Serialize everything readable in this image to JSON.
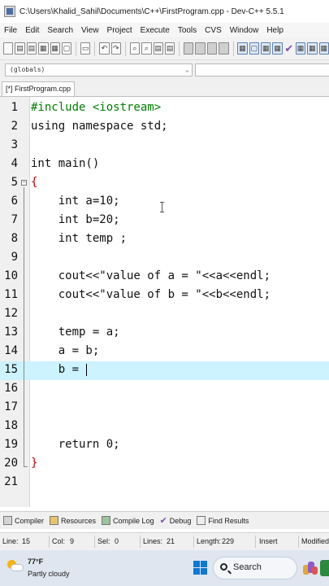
{
  "window": {
    "title": "C:\\Users\\Khalid_Sahil\\Documents\\C++\\FirstProgram.cpp - Dev-C++ 5.5.1"
  },
  "menu": [
    "File",
    "Edit",
    "Search",
    "View",
    "Project",
    "Execute",
    "Tools",
    "CVS",
    "Window",
    "Help"
  ],
  "toolbar": {
    "icons": [
      "new-file-icon",
      "open-project-icon",
      "open-file-icon",
      "save-icon",
      "save-all-icon",
      "close-icon",
      "print-icon",
      "undo-icon",
      "redo-icon",
      "find-icon",
      "replace-icon",
      "find-next-icon",
      "goto-line-icon",
      "indent-icon",
      "unindent-icon",
      "toggle-bookmark-icon",
      "goto-bookmark-icon",
      "compile-icon",
      "run-icon",
      "compile-run-icon",
      "rebuild-icon",
      "check-syntax-icon",
      "debug-icon",
      "profile-icon",
      "stop-icon"
    ]
  },
  "globals": {
    "value": "(globals)"
  },
  "file_tab": {
    "label": "[*] FirstProgram.cpp"
  },
  "editor": {
    "current_line": 15,
    "lines": [
      {
        "n": "1",
        "text": "#include <iostream>"
      },
      {
        "n": "2",
        "text": "using namespace std;"
      },
      {
        "n": "3",
        "text": ""
      },
      {
        "n": "4",
        "text": "int main()"
      },
      {
        "n": "5",
        "text": "{"
      },
      {
        "n": "6",
        "text": "    int a=10;"
      },
      {
        "n": "7",
        "text": "    int b=20;"
      },
      {
        "n": "8",
        "text": "    int temp ;"
      },
      {
        "n": "9",
        "text": ""
      },
      {
        "n": "10",
        "text": "    cout<<\"value of a = \"<<a<<endl;"
      },
      {
        "n": "11",
        "text": "    cout<<\"value of b = \"<<b<<endl;"
      },
      {
        "n": "12",
        "text": ""
      },
      {
        "n": "13",
        "text": "    temp = a;"
      },
      {
        "n": "14",
        "text": "    a = b;"
      },
      {
        "n": "15",
        "text": "    b = "
      },
      {
        "n": "16",
        "text": ""
      },
      {
        "n": "17",
        "text": ""
      },
      {
        "n": "18",
        "text": ""
      },
      {
        "n": "19",
        "text": "    return 0;"
      },
      {
        "n": "20",
        "text": "}"
      },
      {
        "n": "21",
        "text": ""
      }
    ]
  },
  "panel_tabs": [
    {
      "label": "Compiler",
      "icon": "compiler-icon"
    },
    {
      "label": "Resources",
      "icon": "resources-icon"
    },
    {
      "label": "Compile Log",
      "icon": "compile-log-icon"
    },
    {
      "label": "Debug",
      "icon": "debug-check-icon"
    },
    {
      "label": "Find Results",
      "icon": "find-results-icon"
    }
  ],
  "status": {
    "line_label": "Line:",
    "line_value": "15",
    "col_label": "Col:",
    "col_value": "9",
    "sel_label": "Sel:",
    "sel_value": "0",
    "lines_label": "Lines:",
    "lines_value": "21",
    "length_label": "Length:",
    "length_value": "229",
    "mode": "Insert",
    "modified": "Modified"
  },
  "taskbar": {
    "temperature": "77°F",
    "weather": "Partly cloudy",
    "search": "Search"
  },
  "colors": {
    "current_line": "#ccf3ff",
    "preprocessor": "#008000",
    "string": "#0000c0",
    "operator": "#cc0000",
    "number": "#7a00a0"
  }
}
